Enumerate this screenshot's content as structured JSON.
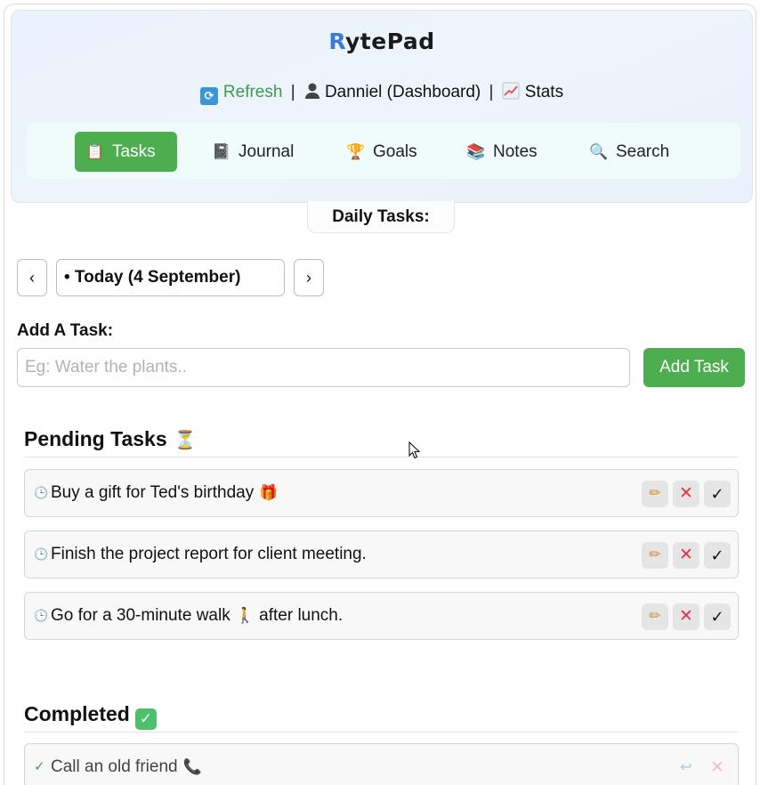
{
  "app": {
    "logo_initial": "R",
    "logo_rest": "ytePad"
  },
  "userbar": {
    "refresh_label": "Refresh",
    "user_label": "Danniel (Dashboard)",
    "stats_label": "Stats",
    "separator": "|"
  },
  "nav": {
    "items": [
      {
        "label": "Tasks",
        "icon": "clipboard-icon",
        "active": true
      },
      {
        "label": "Journal",
        "icon": "notebook-icon",
        "active": false
      },
      {
        "label": "Goals",
        "icon": "trophy-icon",
        "active": false
      },
      {
        "label": "Notes",
        "icon": "books-icon",
        "active": false
      },
      {
        "label": "Search",
        "icon": "magnifier-icon",
        "active": false
      }
    ]
  },
  "section_title": "Daily Tasks:",
  "date_nav": {
    "prev": "‹",
    "next": "›",
    "current": "• Today (4 September)"
  },
  "add_task": {
    "label": "Add A Task:",
    "placeholder": "Eg: Water the plants..",
    "value": "",
    "button_label": "Add Task"
  },
  "pending": {
    "heading": "Pending Tasks",
    "icon": "hourglass-icon",
    "tasks": [
      {
        "text": "Buy a gift for Ted's birthday",
        "emoji": "🎁"
      },
      {
        "text": "Finish the project report for client meeting.",
        "emoji": ""
      },
      {
        "text": "Go for a 30-minute walk",
        "emoji": "🚶",
        "suffix": "after lunch."
      }
    ]
  },
  "completed": {
    "heading": "Completed",
    "icon": "check-box-icon",
    "tasks": [
      {
        "text": "Call an old friend",
        "emoji": "📞"
      }
    ]
  },
  "colors": {
    "accent_green": "#4cae4f",
    "refresh_green": "#3e9a4f",
    "header_bg": "#eaf2fb",
    "nav_bg": "#f0fbfb",
    "delete_red": "#e0334a"
  }
}
